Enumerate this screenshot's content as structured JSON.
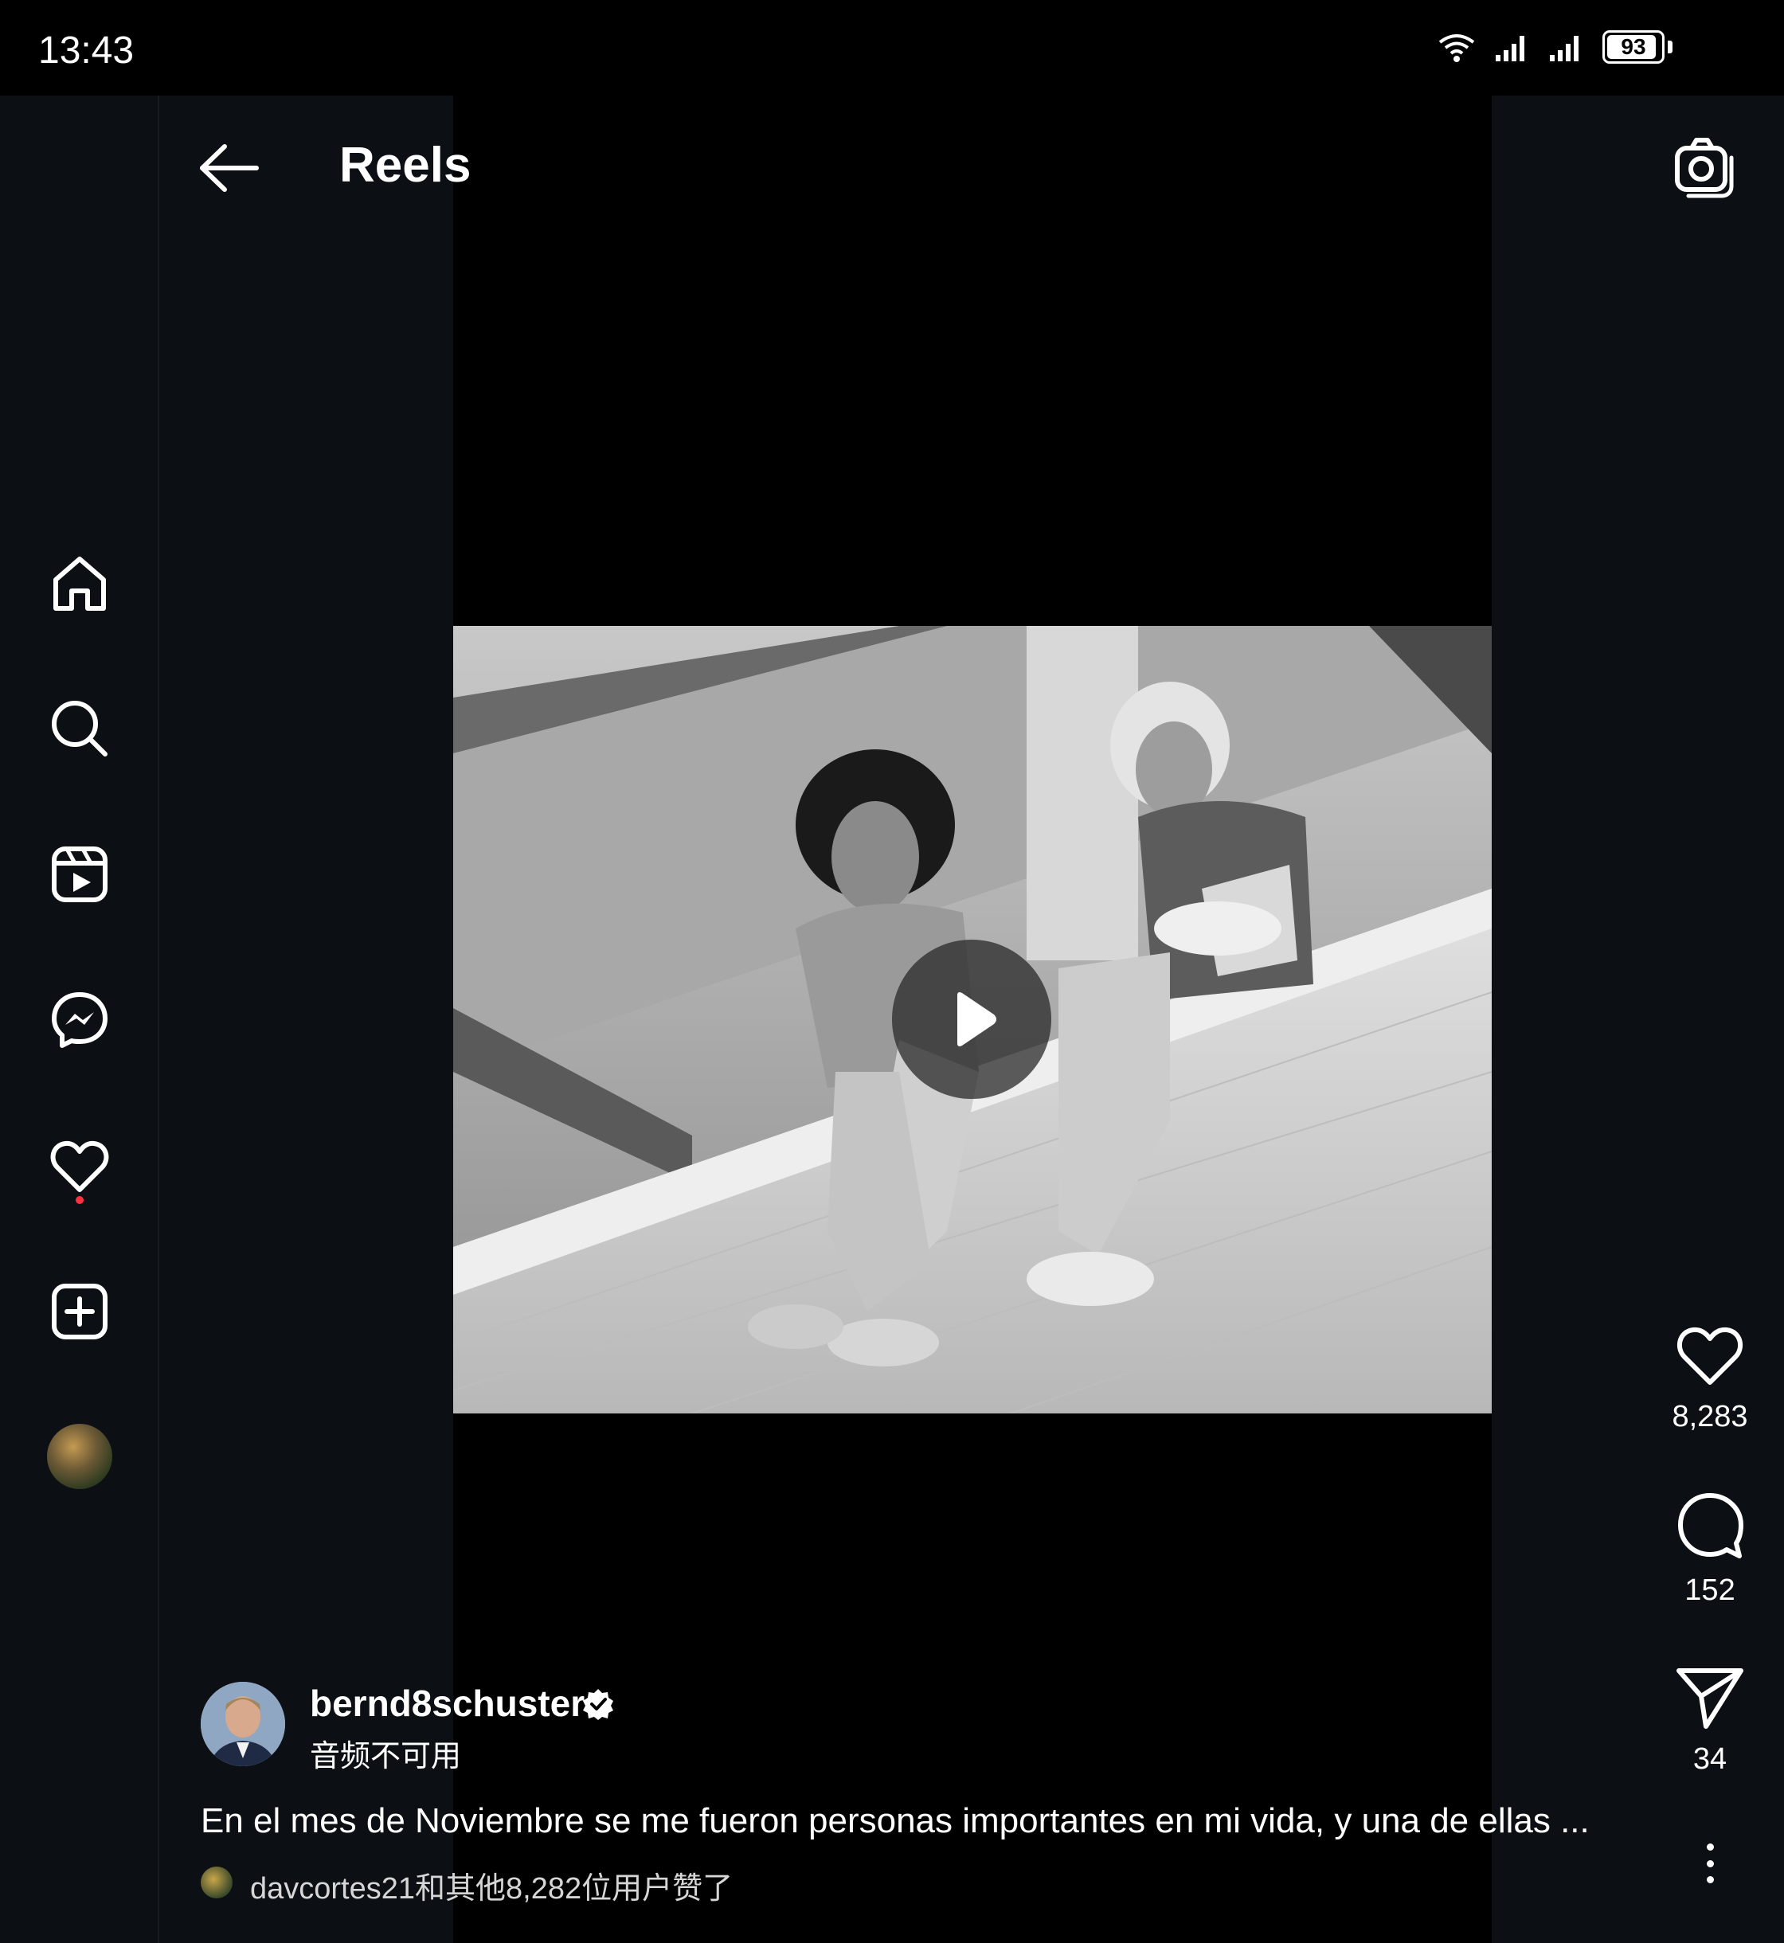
{
  "status_bar": {
    "time": "13:43",
    "battery": "93",
    "battery_level": 0.93,
    "icons": [
      "wifi-icon",
      "signal-icon",
      "signal-icon",
      "battery-icon"
    ]
  },
  "nav": {
    "items": [
      {
        "name": "home",
        "icon": "home-icon"
      },
      {
        "name": "search",
        "icon": "search-icon"
      },
      {
        "name": "reels",
        "icon": "reels-icon"
      },
      {
        "name": "messenger",
        "icon": "messenger-icon"
      },
      {
        "name": "notifications",
        "icon": "heart-icon",
        "has_badge": true
      },
      {
        "name": "create",
        "icon": "plus-square-icon"
      },
      {
        "name": "profile",
        "icon": "avatar"
      }
    ]
  },
  "header": {
    "title": "Reels",
    "back_icon": "arrow-left-icon",
    "camera_icon": "camera-icon"
  },
  "reel": {
    "author": "bernd8schuster",
    "verified": true,
    "audio": "音频不可用",
    "caption": "En el mes  de Noviembre se me fueron personas importantes en mi vida, y una de ellas ...",
    "liked_by": "davcortes21和其他8,282位用户赞了",
    "likes": "8,283",
    "comments": "152",
    "shares": "34"
  },
  "colors": {
    "background": "#000000",
    "rail": "#0c0f14",
    "badge": "#ff3040",
    "text": "#ffffff"
  }
}
